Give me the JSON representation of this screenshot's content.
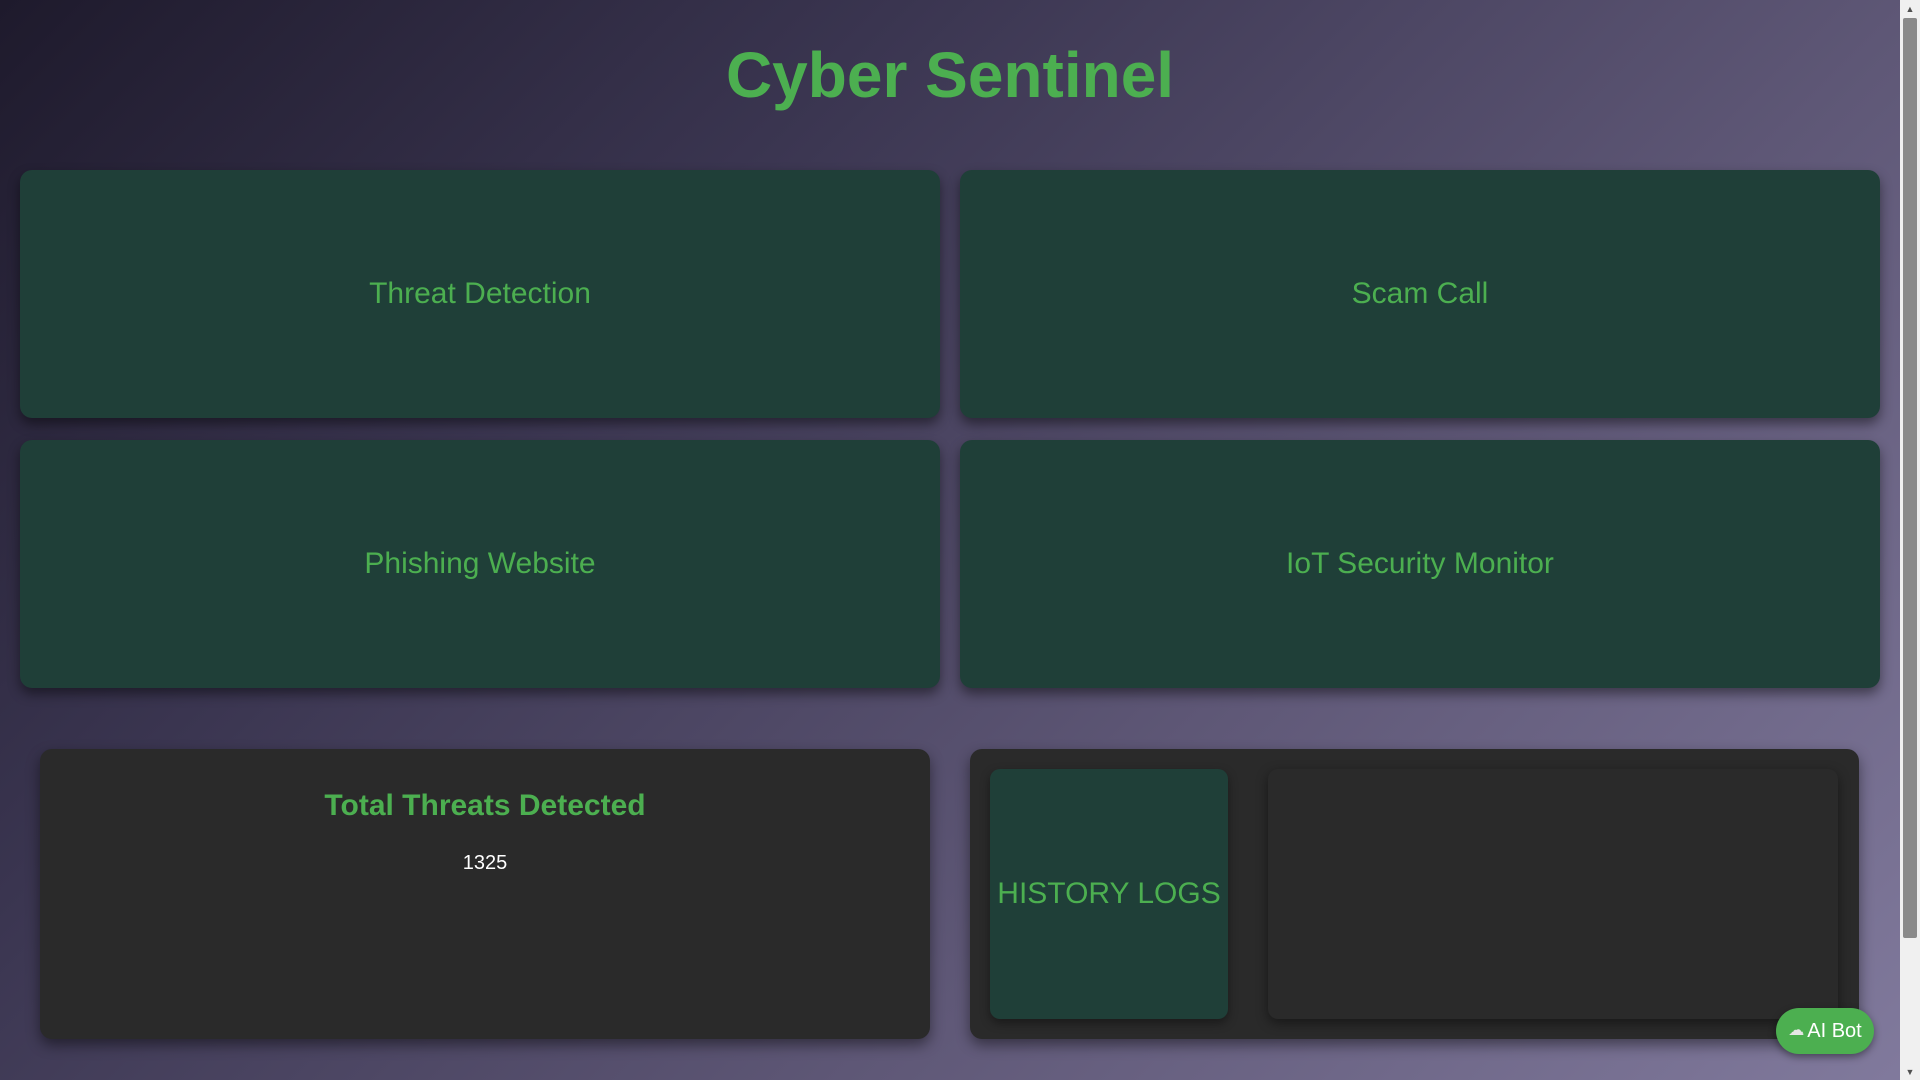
{
  "app": {
    "title": "Cyber Sentinel"
  },
  "features": [
    {
      "label": "Threat Detection"
    },
    {
      "label": "Scam Call"
    },
    {
      "label": "Phishing Website"
    },
    {
      "label": "IoT Security Monitor"
    }
  ],
  "stats": {
    "heading": "Total Threats Detected",
    "value": "1325"
  },
  "history": {
    "button_label": "HISTORY LOGS"
  },
  "ai_bot": {
    "label": "AI Bot",
    "icon": "robot-icon"
  },
  "colors": {
    "accent": "#4caf50",
    "card": "#1f3f38",
    "panel": "#2a2a2a"
  }
}
